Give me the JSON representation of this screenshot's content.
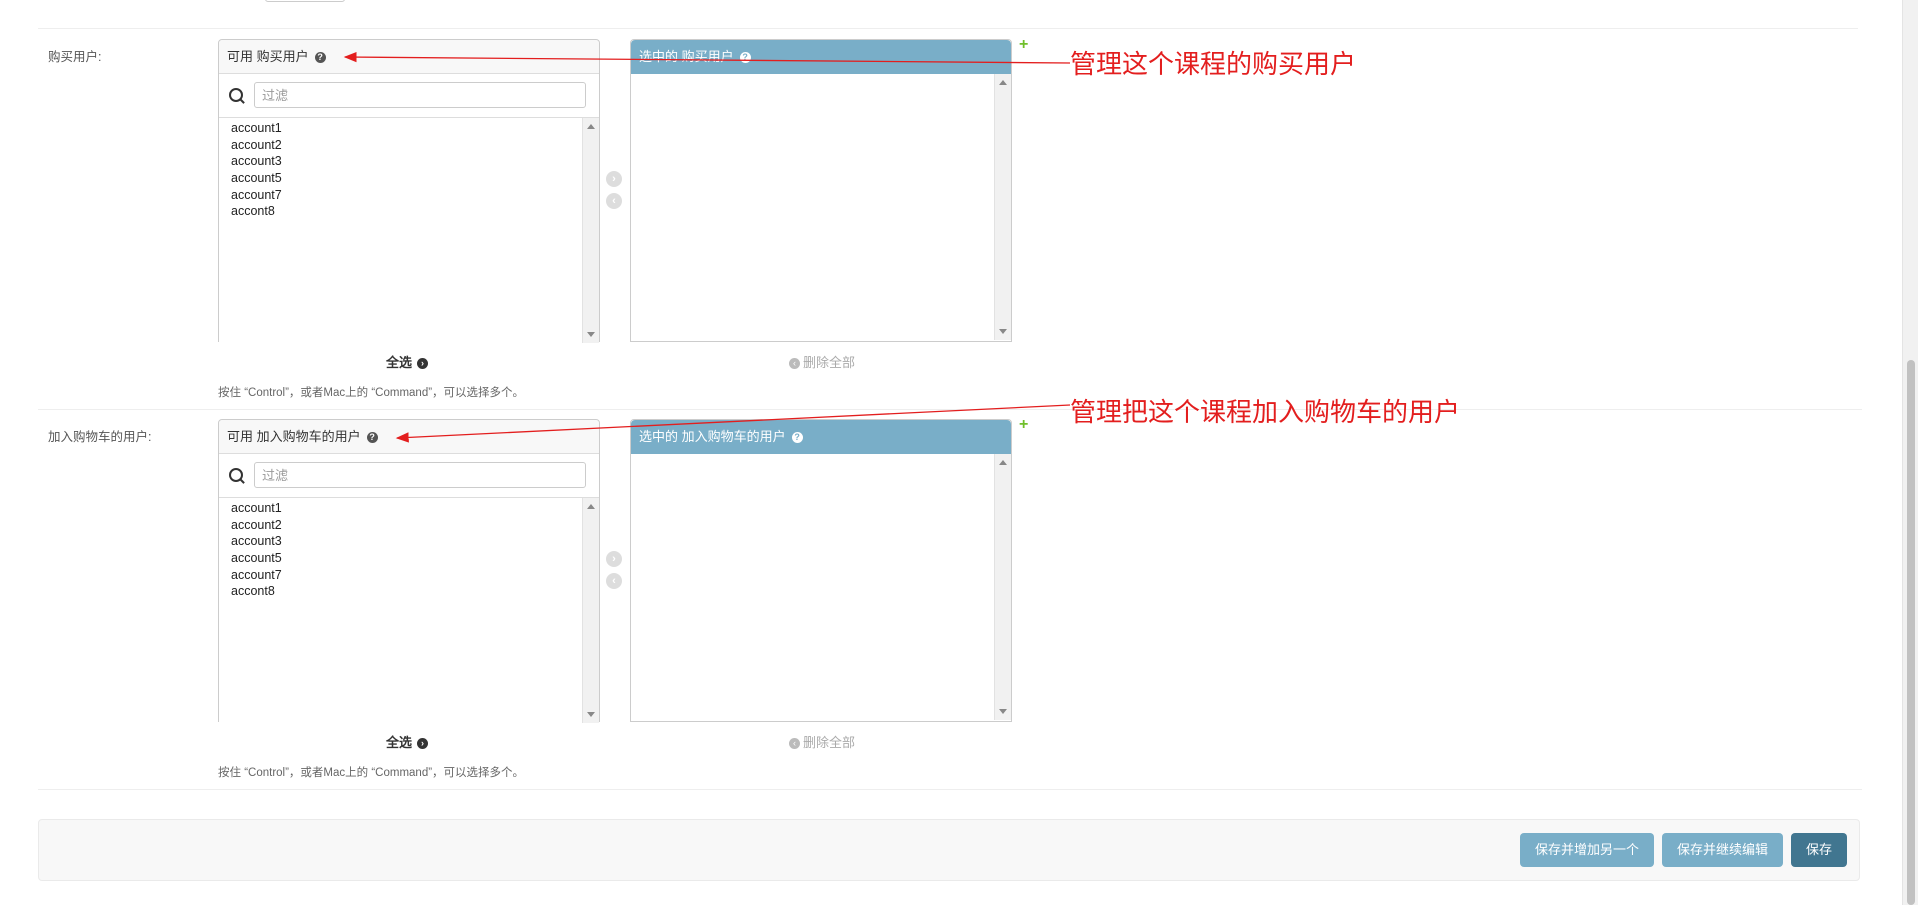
{
  "fields": [
    {
      "label": "购买用户:",
      "available_title": "可用 购买用户",
      "chosen_title": "选中的 购买用户",
      "filter_placeholder": "过滤",
      "available_items": [
        "account1",
        "account2",
        "account3",
        "account5",
        "account7",
        "accont8"
      ],
      "choose_all": "全选",
      "remove_all": "删除全部",
      "help_text": "按住 “Control”，或者Mac上的 “Command”，可以选择多个。",
      "annotation": "管理这个课程的购买用户"
    },
    {
      "label": "加入购物车的用户:",
      "available_title": "可用 加入购物车的用户",
      "chosen_title": "选中的 加入购物车的用户",
      "filter_placeholder": "过滤",
      "available_items": [
        "account1",
        "account2",
        "account3",
        "account5",
        "account7",
        "accont8"
      ],
      "choose_all": "全选",
      "remove_all": "删除全部",
      "help_text": "按住 “Control”，或者Mac上的 “Command”，可以选择多个。",
      "annotation": "管理把这个课程加入购物车的用户"
    }
  ],
  "icons": {
    "help": "question-circle-icon",
    "search": "search-icon",
    "add": "plus-icon",
    "move_right": "arrow-right-circle-icon",
    "move_left": "arrow-left-circle-icon"
  },
  "submit_row": {
    "save_add_another": "保存并增加另一个",
    "save_continue": "保存并继续编辑",
    "save": "保存"
  },
  "colors": {
    "chosen_header": "#79aec8",
    "primary_button": "#417690",
    "secondary_button": "#79aec8",
    "annotation": "#e31e1e",
    "add_icon": "#70bf2b"
  }
}
